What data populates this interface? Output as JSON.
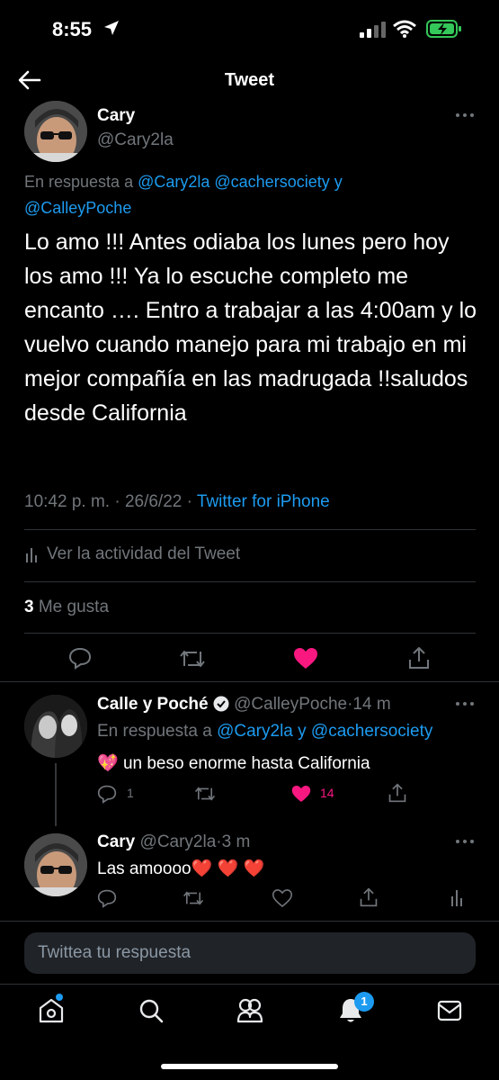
{
  "status_bar": {
    "time": "8:55"
  },
  "header": {
    "title": "Tweet"
  },
  "main_tweet": {
    "name": "Cary",
    "handle": "@Cary2la",
    "reply_prefix": "En respuesta a",
    "reply_users_line1": "@Cary2la @cachersociety",
    "reply_conj": "y",
    "reply_users_line2": "@CalleyPoche",
    "text": "Lo amo !!! Antes odiaba los lunes pero hoy los amo !!! Ya lo escuche completo me encanto …. Entro a trabajar a las 4:00am y lo vuelvo  cuando manejo para mi trabajo en mi mejor compañía en las madrugada !!saludos desde California",
    "time": "10:42 p. m.",
    "sep": "·",
    "date": "26/6/22",
    "source": "Twitter for iPhone",
    "activity": "Ver la actividad del Tweet",
    "likes_count": "3",
    "likes_label": "Me gusta"
  },
  "reply1": {
    "name": "Calle y Poché",
    "handle": "@CalleyPoche",
    "dot": "·",
    "time": "14 m",
    "reply_prefix": "En respuesta a",
    "reply_user1": "@Cary2la",
    "reply_conj": "y",
    "reply_user2": "@cachersociety",
    "emoji": "💖",
    "text": "un beso enorme hasta California",
    "reply_count": "1",
    "like_count": "14"
  },
  "reply2": {
    "name": "Cary",
    "handle": "@Cary2la",
    "dot": "·",
    "time": "3 m",
    "text": "Las amoooo❤️ ❤️ ❤️"
  },
  "compose": {
    "placeholder": "Twittea tu respuesta"
  },
  "tabbar": {
    "notifications_badge": "1"
  },
  "colors": {
    "accent": "#1d9bf0",
    "like": "#f91880",
    "muted": "#71767b"
  }
}
